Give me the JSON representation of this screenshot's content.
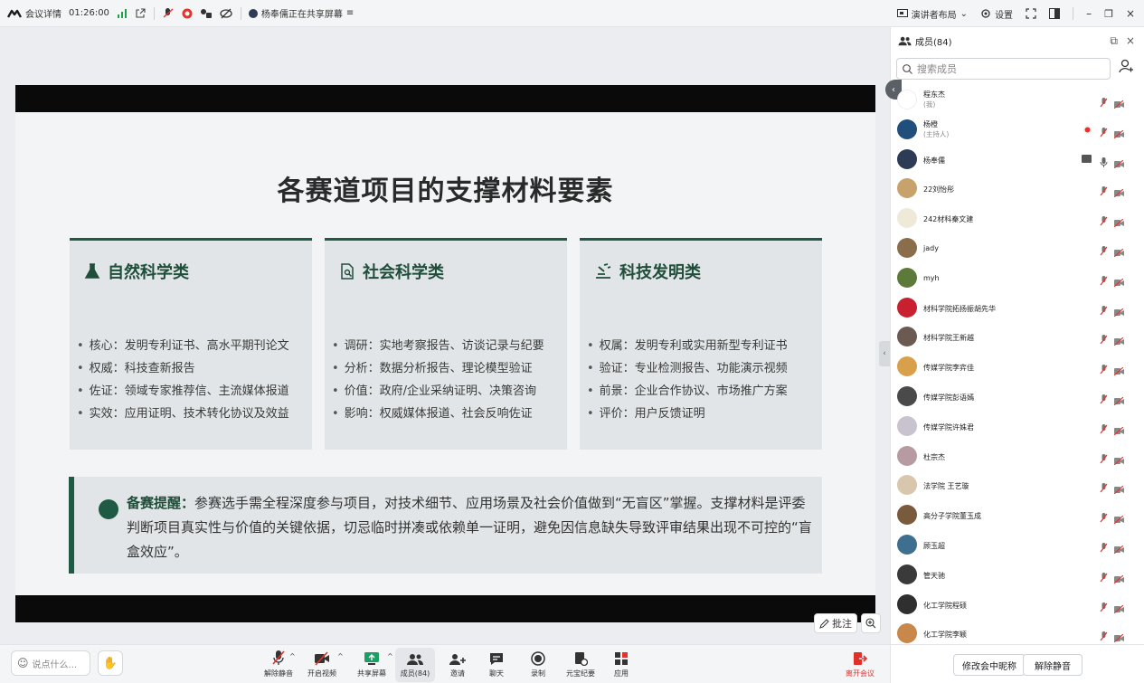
{
  "topbar": {
    "meeting_details": "会议详情",
    "duration": "01:26:00",
    "sharing_status": "杨奉儒正在共享屏幕",
    "layout_label": "演讲者布局",
    "settings_label": "设置"
  },
  "slide": {
    "title": "各赛道项目的支撑材料要素",
    "cards": [
      {
        "heading": "自然科学类",
        "items": [
          "核心：发明专利证书、高水平期刊论文",
          "权威：科技查新报告",
          "佐证：领域专家推荐信、主流媒体报道",
          "实效：应用证明、技术转化协议及效益"
        ]
      },
      {
        "heading": "社会科学类",
        "items": [
          "调研：实地考察报告、访谈记录与纪要",
          "分析：数据分析报告、理论模型验证",
          "价值：政府/企业采纳证明、决策咨询",
          "影响：权威媒体报道、社会反响佐证"
        ]
      },
      {
        "heading": "科技发明类",
        "items": [
          "权属：发明专利或实用新型专利证书",
          "验证：专业检测报告、功能演示视频",
          "前景：企业合作协议、市场推广方案",
          "评价：用户反馈证明"
        ]
      }
    ],
    "tip_label": "备赛提醒：",
    "tip_text": "参赛选手需全程深度参与项目，对技术细节、应用场景及社会价值做到“无盲区”掌握。支撑材料是评委判断项目真实性与价值的关键依据，切忌临时拼凑或依赖单一证明，避免因信息缺失导致评审结果出现不可控的“盲盒效应”。"
  },
  "annotate_label": "批注",
  "bottombar": {
    "say_placeholder": "说点什么...",
    "tools": {
      "unmute": "解除静音",
      "video": "开启视频",
      "share": "共享屏幕",
      "members": "成员(84)",
      "invite": "邀请",
      "chat": "聊天",
      "record": "录制",
      "summary": "元宝纪要",
      "apps": "应用"
    },
    "leave": "离开会议"
  },
  "panel": {
    "title": "成员(84)",
    "search_placeholder": "搜索成员",
    "members": [
      {
        "name": "程东杰",
        "role": "(我)",
        "color": "#ffffff"
      },
      {
        "name": "杨橙",
        "role": "(主持人)",
        "color": "#1f4f7a"
      },
      {
        "name": "杨奉儒",
        "role": "",
        "color": "#2d3b55"
      },
      {
        "name": "22刘怡彤",
        "role": "",
        "color": "#c7a36b"
      },
      {
        "name": "242材科秦文建",
        "role": "",
        "color": "#efe9d8"
      },
      {
        "name": "jady",
        "role": "",
        "color": "#8a6d4a"
      },
      {
        "name": "myh",
        "role": "",
        "color": "#5d7a3b"
      },
      {
        "name": "材科学院拓扬振胡先华",
        "role": "",
        "color": "#c8202f"
      },
      {
        "name": "材科学院王新越",
        "role": "",
        "color": "#6b5a52"
      },
      {
        "name": "传媒学院李弈佳",
        "role": "",
        "color": "#d9a04b"
      },
      {
        "name": "传媒学院彭语嫣",
        "role": "",
        "color": "#4a4a4a"
      },
      {
        "name": "传媒学院许姝君",
        "role": "",
        "color": "#c9c3cf"
      },
      {
        "name": "杜宗杰",
        "role": "",
        "color": "#b89aa2"
      },
      {
        "name": "法学院 王艺璇",
        "role": "",
        "color": "#d8c7ad"
      },
      {
        "name": "高分子学院董玉成",
        "role": "",
        "color": "#7a5a3c"
      },
      {
        "name": "顾玉超",
        "role": "",
        "color": "#3e6f8f"
      },
      {
        "name": "管天驰",
        "role": "",
        "color": "#3a3a3a"
      },
      {
        "name": "化工学院程硕",
        "role": "",
        "color": "#2f2f2f"
      },
      {
        "name": "化工学院李颖",
        "role": "",
        "color": "#c9874a"
      }
    ],
    "rename_button": "修改会中昵称",
    "unmute_all": "解除静音"
  },
  "colors": {
    "accent_green": "#1f5a44",
    "leave_red": "#e0302a",
    "record_red": "#e8312a"
  }
}
